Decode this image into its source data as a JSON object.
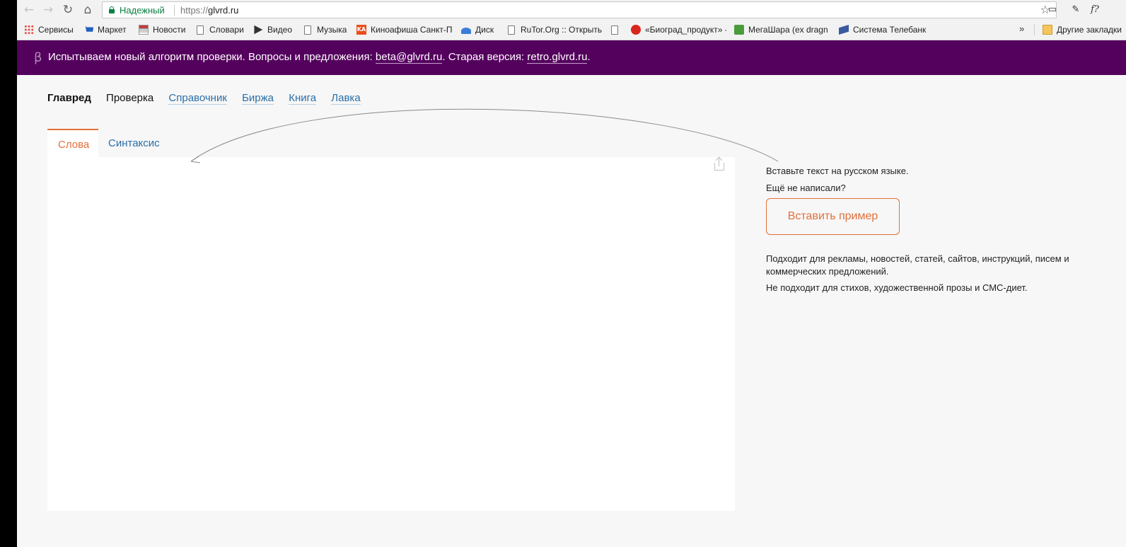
{
  "browser": {
    "secure_label": "Надежный",
    "url_scheme": "https://",
    "url_host": "glvrd.ru",
    "bookmarks": [
      {
        "label": "Сервисы",
        "icon": "apps-grid-icon"
      },
      {
        "label": "Маркет",
        "icon": "cart-icon"
      },
      {
        "label": "Новости",
        "icon": "news-icon"
      },
      {
        "label": "Словари",
        "icon": "page-icon"
      },
      {
        "label": "Видео",
        "icon": "play-icon"
      },
      {
        "label": "Музыка",
        "icon": "page-icon"
      },
      {
        "label": "Киноафиша Санкт-П",
        "icon": "ka-icon"
      },
      {
        "label": "Диск",
        "icon": "disk-icon"
      },
      {
        "label": "RuTor.Org :: Открыть",
        "icon": "page-icon"
      },
      {
        "label": "",
        "icon": "page-icon"
      },
      {
        "label": "«Биоград_продукт» -",
        "icon": "tomato-icon"
      },
      {
        "label": "МегаШара (ex dragn",
        "icon": "check-icon"
      },
      {
        "label": "Система Телебанк",
        "icon": "bank-icon"
      },
      {
        "label": "Другие закладки",
        "icon": "folder-icon"
      }
    ],
    "more_label": "»"
  },
  "banner": {
    "beta_symbol": "β",
    "text_before": "Испытываем новый алгоритм проверки. Вопросы и предложения: ",
    "email": "beta@glvrd.ru",
    "text_middle": ". Старая версия: ",
    "retro_link": "retro.glvrd.ru",
    "text_after": "."
  },
  "nav": {
    "brand": "Главред",
    "check": "Проверка",
    "reference": "Справочник",
    "exchange": "Биржа",
    "book": "Книга",
    "shop": "Лавка"
  },
  "tabs": {
    "words": "Слова",
    "syntax": "Синтаксис"
  },
  "editor": {
    "text": ""
  },
  "help": {
    "paste_prompt": "Вставьте текст на русском языке.",
    "not_written": "Ещё не написали?",
    "paste_button": "Вставить пример",
    "suitable": "Подходит для рекламы, новостей, статей, сайтов, инструкций, писем и коммерческих предложений.",
    "not_suitable": "Не подходит для стихов, художественной прозы и СМС-диет."
  },
  "colors": {
    "banner": "#54005d",
    "accent": "#e2703a",
    "link": "#2a6fa8"
  }
}
